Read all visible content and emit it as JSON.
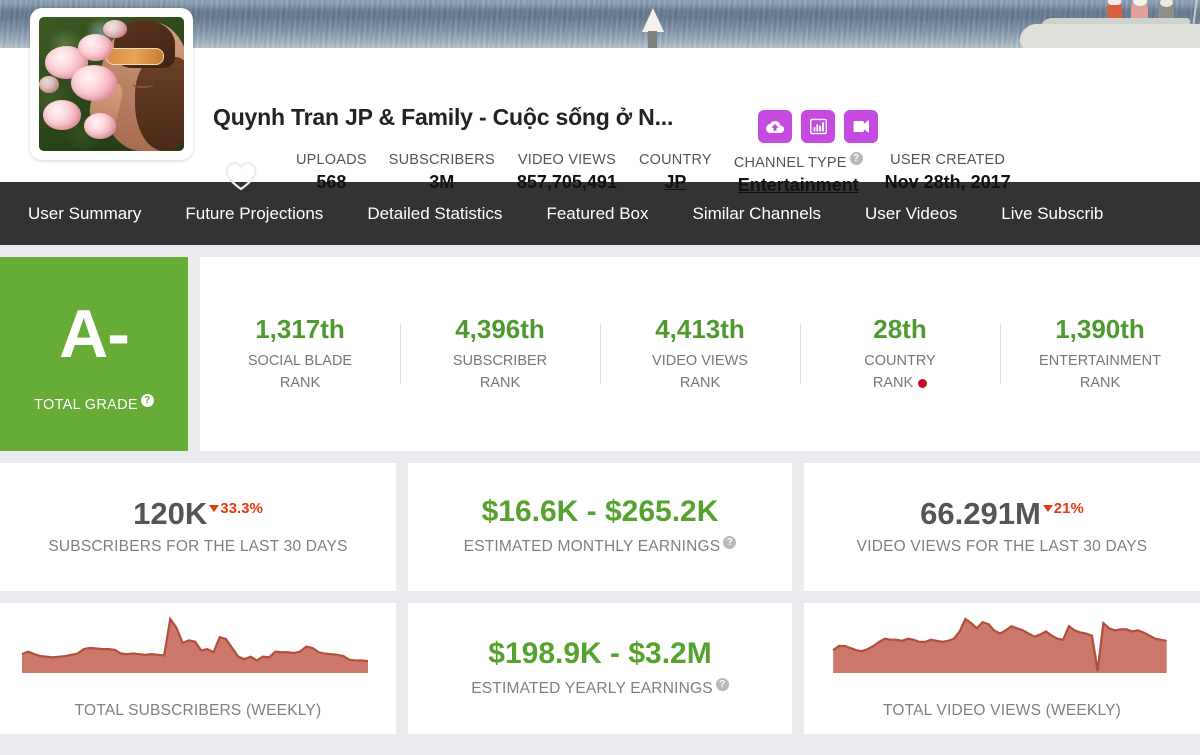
{
  "banner": {
    "alt": "channel-banner-sea-boat"
  },
  "profile": {
    "avatar_alt": "channel-avatar-woman-with-roses",
    "title": "Quynh Tran JP & Family - Cuộc sống ở N...",
    "action_buttons": [
      {
        "name": "upload-icon",
        "label": "cloud-upload"
      },
      {
        "name": "stats-icon",
        "label": "bar-chart"
      },
      {
        "name": "video-icon",
        "label": "video-camera"
      }
    ],
    "favorite_icon": "heart-icon",
    "stats": [
      {
        "label": "UPLOADS",
        "value": "568",
        "link": false,
        "help": false
      },
      {
        "label": "SUBSCRIBERS",
        "value": "3M",
        "link": false,
        "help": false
      },
      {
        "label": "VIDEO VIEWS",
        "value": "857,705,491",
        "link": false,
        "help": false
      },
      {
        "label": "COUNTRY",
        "value": "JP",
        "link": true,
        "help": false
      },
      {
        "label": "CHANNEL TYPE",
        "value": "Entertainment",
        "link": true,
        "help": true
      },
      {
        "label": "USER CREATED",
        "value": "Nov 28th, 2017",
        "link": false,
        "help": false
      }
    ]
  },
  "nav": {
    "items": [
      "User Summary",
      "Future Projections",
      "Detailed Statistics",
      "Featured Box",
      "Similar Channels",
      "User Videos",
      "Live Subscrib"
    ]
  },
  "grade": {
    "letter": "A-",
    "label": "TOTAL GRADE",
    "color": "#66ac36"
  },
  "ranks": [
    {
      "value": "1,317th",
      "label_line1": "SOCIAL BLADE",
      "label_line2": "RANK",
      "dot": false
    },
    {
      "value": "4,396th",
      "label_line1": "SUBSCRIBER",
      "label_line2": "RANK",
      "dot": false
    },
    {
      "value": "4,413th",
      "label_line1": "VIDEO VIEWS",
      "label_line2": "RANK",
      "dot": false
    },
    {
      "value": "28th",
      "label_line1": "COUNTRY",
      "label_line2": "RANK",
      "dot": true
    },
    {
      "value": "1,390th",
      "label_line1": "ENTERTAINMENT",
      "label_line2": "RANK",
      "dot": false
    }
  ],
  "cards": {
    "subs_30d": {
      "value": "120K",
      "delta": "33.3%",
      "delta_dir": "down",
      "label": "SUBSCRIBERS FOR THE LAST 30 DAYS"
    },
    "monthly_earnings": {
      "value": "$16.6K - $265.2K",
      "label": "ESTIMATED MONTHLY EARNINGS",
      "help": true
    },
    "views_30d": {
      "value": "66.291M",
      "delta": "21%",
      "delta_dir": "down",
      "label": "VIDEO VIEWS FOR THE LAST 30 DAYS"
    },
    "subs_weekly": {
      "label": "TOTAL SUBSCRIBERS (WEEKLY)"
    },
    "yearly_earnings": {
      "value": "$198.9K - $3.2M",
      "label": "ESTIMATED YEARLY EARNINGS",
      "help": true
    },
    "views_weekly": {
      "label": "TOTAL VIDEO VIEWS (WEEKLY)"
    }
  },
  "colors": {
    "accent_green": "#66ac36",
    "rank_green": "#4f9a2e",
    "earnings_green": "#55a32c",
    "delta_red": "#e23b13",
    "nav_bg": "#333333",
    "page_bg": "#e9ebee",
    "button_purple": "#c44ae0",
    "spark_fill": "#c97162",
    "spark_stroke": "#b3503d"
  },
  "chart_data": [
    {
      "type": "area",
      "title": "TOTAL SUBSCRIBERS (WEEKLY)",
      "xlabel": "",
      "ylabel": "",
      "grid": false,
      "legend": "none",
      "values": [
        30,
        34,
        30,
        27,
        26,
        25,
        26,
        27,
        29,
        31,
        38,
        40,
        39,
        38,
        38,
        37,
        31,
        30,
        31,
        30,
        29,
        30,
        29,
        28,
        86,
        72,
        48,
        52,
        50,
        36,
        38,
        33,
        57,
        54,
        40,
        26,
        22,
        26,
        20,
        26,
        25,
        34,
        33,
        33,
        32,
        34,
        42,
        40,
        33,
        31,
        30,
        29,
        27,
        21,
        20,
        20,
        19
      ]
    },
    {
      "type": "area",
      "title": "TOTAL VIDEO VIEWS (WEEKLY)",
      "xlabel": "",
      "ylabel": "",
      "grid": false,
      "legend": "none",
      "values": [
        22,
        26,
        26,
        24,
        22,
        21,
        23,
        26,
        30,
        33,
        32,
        32,
        31,
        33,
        32,
        30,
        30,
        32,
        31,
        30,
        31,
        33,
        40,
        52,
        48,
        43,
        49,
        47,
        41,
        38,
        41,
        45,
        43,
        41,
        38,
        35,
        37,
        40,
        36,
        33,
        32,
        45,
        41,
        39,
        38,
        36,
        2,
        48,
        43,
        41,
        42,
        42,
        40,
        41,
        39,
        36,
        33,
        32,
        31
      ]
    }
  ]
}
